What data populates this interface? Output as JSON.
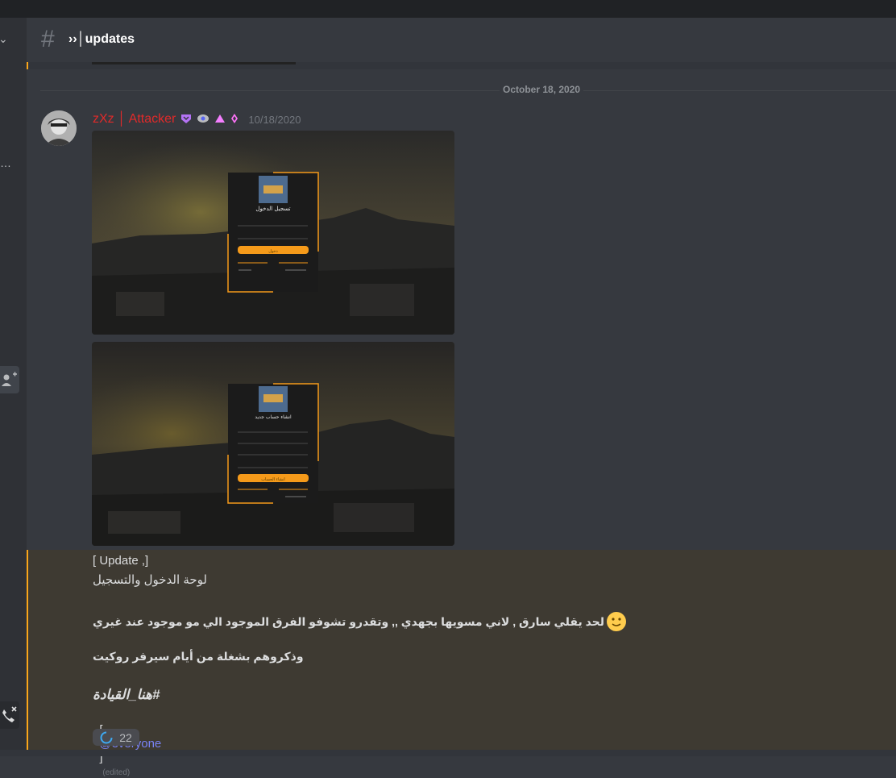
{
  "channel": {
    "hash_symbol": "#",
    "name": "››│updates"
  },
  "date_divider": "October 18, 2020",
  "message": {
    "author": "zXz │ Attacker",
    "timestamp": "10/18/2020",
    "lines": {
      "update_tag": "[ Update ,]",
      "line1": "لوحة الدخول والتسجيل",
      "line2": "لحد يقلي سارق , لاني مسويها بجهدي ,, وتقدرو تشوفو الفرق الموجود الي مو موجود عند غيري",
      "line3": "وذكروهم بشغلة من أيام سيرفر روكيت",
      "line4": "#هنا_القيادة",
      "open_bracket": "[",
      "mention": "@everyone",
      "close_bracket": "]",
      "edited": "(edited)"
    },
    "reaction_count": "22"
  },
  "attachments": {
    "login": {
      "title": "تسجيل الدخول",
      "button": "دخول"
    },
    "register": {
      "title": "انشاء حساب جديد",
      "button": "انشاء الحساب"
    }
  },
  "colors": {
    "author": "#e02a2a",
    "accent": "#faa61a",
    "mention": "#7983f5"
  }
}
